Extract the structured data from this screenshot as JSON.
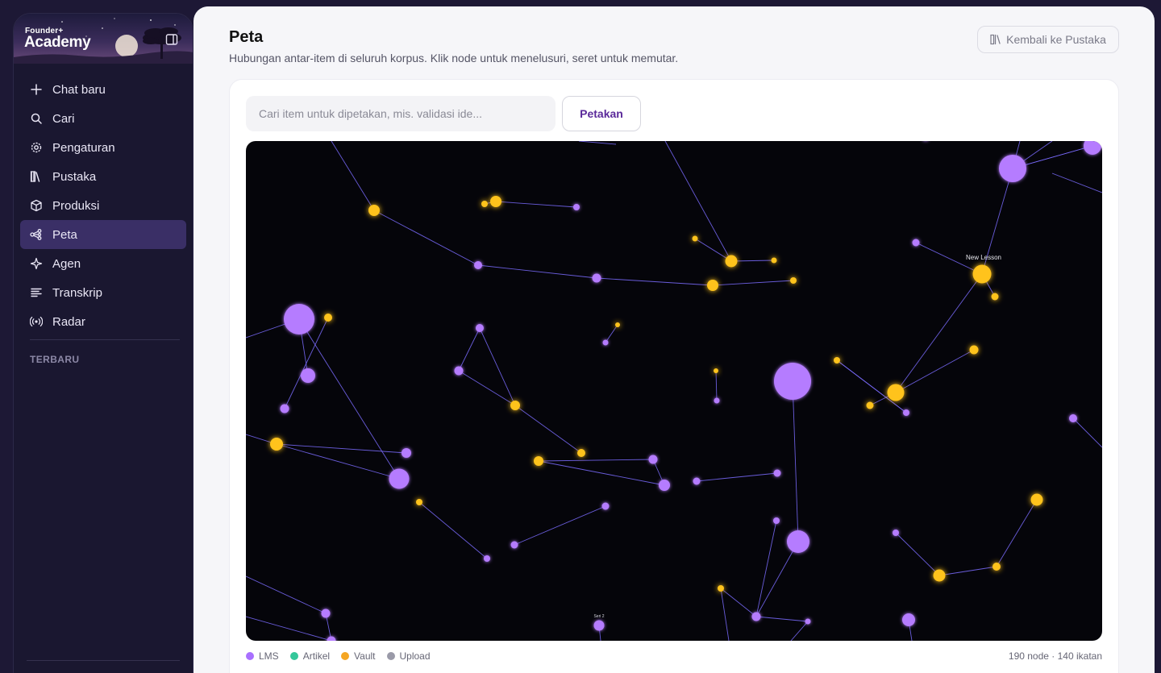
{
  "sidebar": {
    "brand_top": "Founder+",
    "brand_main": "Academy",
    "items": [
      {
        "label": "Chat baru",
        "icon": "plus-icon"
      },
      {
        "label": "Cari",
        "icon": "search-icon"
      },
      {
        "label": "Pengaturan",
        "icon": "gear-icon"
      },
      {
        "label": "Pustaka",
        "icon": "library-icon"
      },
      {
        "label": "Produksi",
        "icon": "box-icon"
      },
      {
        "label": "Peta",
        "icon": "graph-icon",
        "active": true
      },
      {
        "label": "Agen",
        "icon": "sparkle-icon"
      },
      {
        "label": "Transkrip",
        "icon": "lines-icon"
      },
      {
        "label": "Radar",
        "icon": "radar-icon"
      }
    ],
    "recent_label": "TERBARU"
  },
  "header": {
    "title": "Peta",
    "subtitle": "Hubungan antar-item di seluruh korpus. Klik node untuk menelusuri, seret untuk memutar.",
    "back_label": "Kembali ke Pustaka"
  },
  "search": {
    "placeholder": "Cari item untuk dipetakan, mis. validasi ide...",
    "button_label": "Petakan"
  },
  "legend": [
    {
      "label": "LMS",
      "color": "#a970ff"
    },
    {
      "label": "Artikel",
      "color": "#34c79a"
    },
    {
      "label": "Vault",
      "color": "#f5a623"
    },
    {
      "label": "Upload",
      "color": "#9a9aa8"
    }
  ],
  "stats": "190 node · 140 ikatan",
  "graph": {
    "colors": {
      "lms": "#b57cff",
      "vault": "#ffc31a",
      "edge": "#7b6cff"
    },
    "labels": [
      "New Lesson",
      "Seri 2"
    ]
  }
}
